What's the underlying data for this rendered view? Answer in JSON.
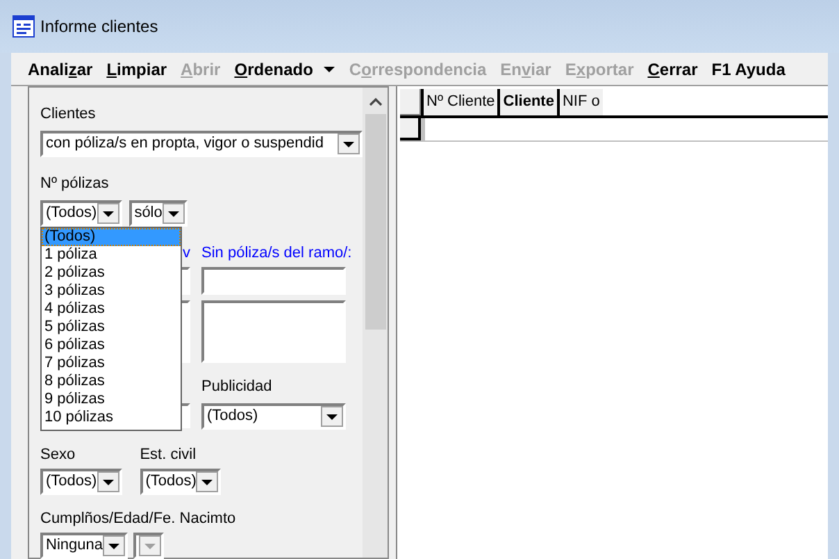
{
  "window": {
    "title": "Informe clientes"
  },
  "menu": [
    {
      "before": "Anali",
      "underlined": "z",
      "after": "ar",
      "disabled": false
    },
    {
      "underlined": "L",
      "after": "impiar",
      "disabled": false
    },
    {
      "underlined": "A",
      "after": "brir",
      "disabled": true
    },
    {
      "underlined": "O",
      "after": "rdenado",
      "disabled": false,
      "dropdown": true
    },
    {
      "before": "C",
      "underlined": "o",
      "after": "rrespondencia",
      "disabled": true
    },
    {
      "before": "En",
      "underlined": "v",
      "after": "iar",
      "disabled": true
    },
    {
      "before": "E",
      "underlined": "x",
      "after": "portar",
      "disabled": true
    },
    {
      "underlined": "C",
      "after": "errar",
      "disabled": false
    },
    {
      "before": "F1 Ayuda",
      "disabled": false
    }
  ],
  "filters": {
    "clientes": {
      "label": "Clientes",
      "value": "con póliza/s en propta, vigor o suspendid"
    },
    "num_polizas": {
      "label": "Nº pólizas",
      "value": "(Todos)",
      "qualifier": "sólo"
    },
    "hidden_label": "v",
    "sin_poliza": {
      "label": "Sin póliza/s del ramo/:"
    },
    "publicidad": {
      "label": "Publicidad",
      "value": "(Todos)"
    },
    "sexo": {
      "label": "Sexo",
      "value": "(Todos)"
    },
    "est_civil": {
      "label": "Est. civil",
      "value": "(Todos)"
    },
    "cumple": {
      "label": "Cumplños/Edad/Fe. Nacimto",
      "value": "Ninguna",
      "second_disabled": true
    }
  },
  "dropdown_list": [
    {
      "label": "(Todos)",
      "selected": true
    },
    {
      "label": "1 póliza",
      "selected": false
    },
    {
      "label": "2 pólizas",
      "selected": false
    },
    {
      "label": "3 pólizas",
      "selected": false
    },
    {
      "label": "4 pólizas",
      "selected": false
    },
    {
      "label": "5 pólizas",
      "selected": false
    },
    {
      "label": "6 pólizas",
      "selected": false
    },
    {
      "label": "7 pólizas",
      "selected": false
    },
    {
      "label": "8 pólizas",
      "selected": false
    },
    {
      "label": "9 pólizas",
      "selected": false
    },
    {
      "label": "10 pólizas",
      "selected": false
    }
  ],
  "table": {
    "columns": [
      {
        "label": "Nº Cliente",
        "bold": false
      },
      {
        "label": "Cliente",
        "bold": true
      },
      {
        "label": "NIF o ",
        "bold": false
      }
    ]
  }
}
